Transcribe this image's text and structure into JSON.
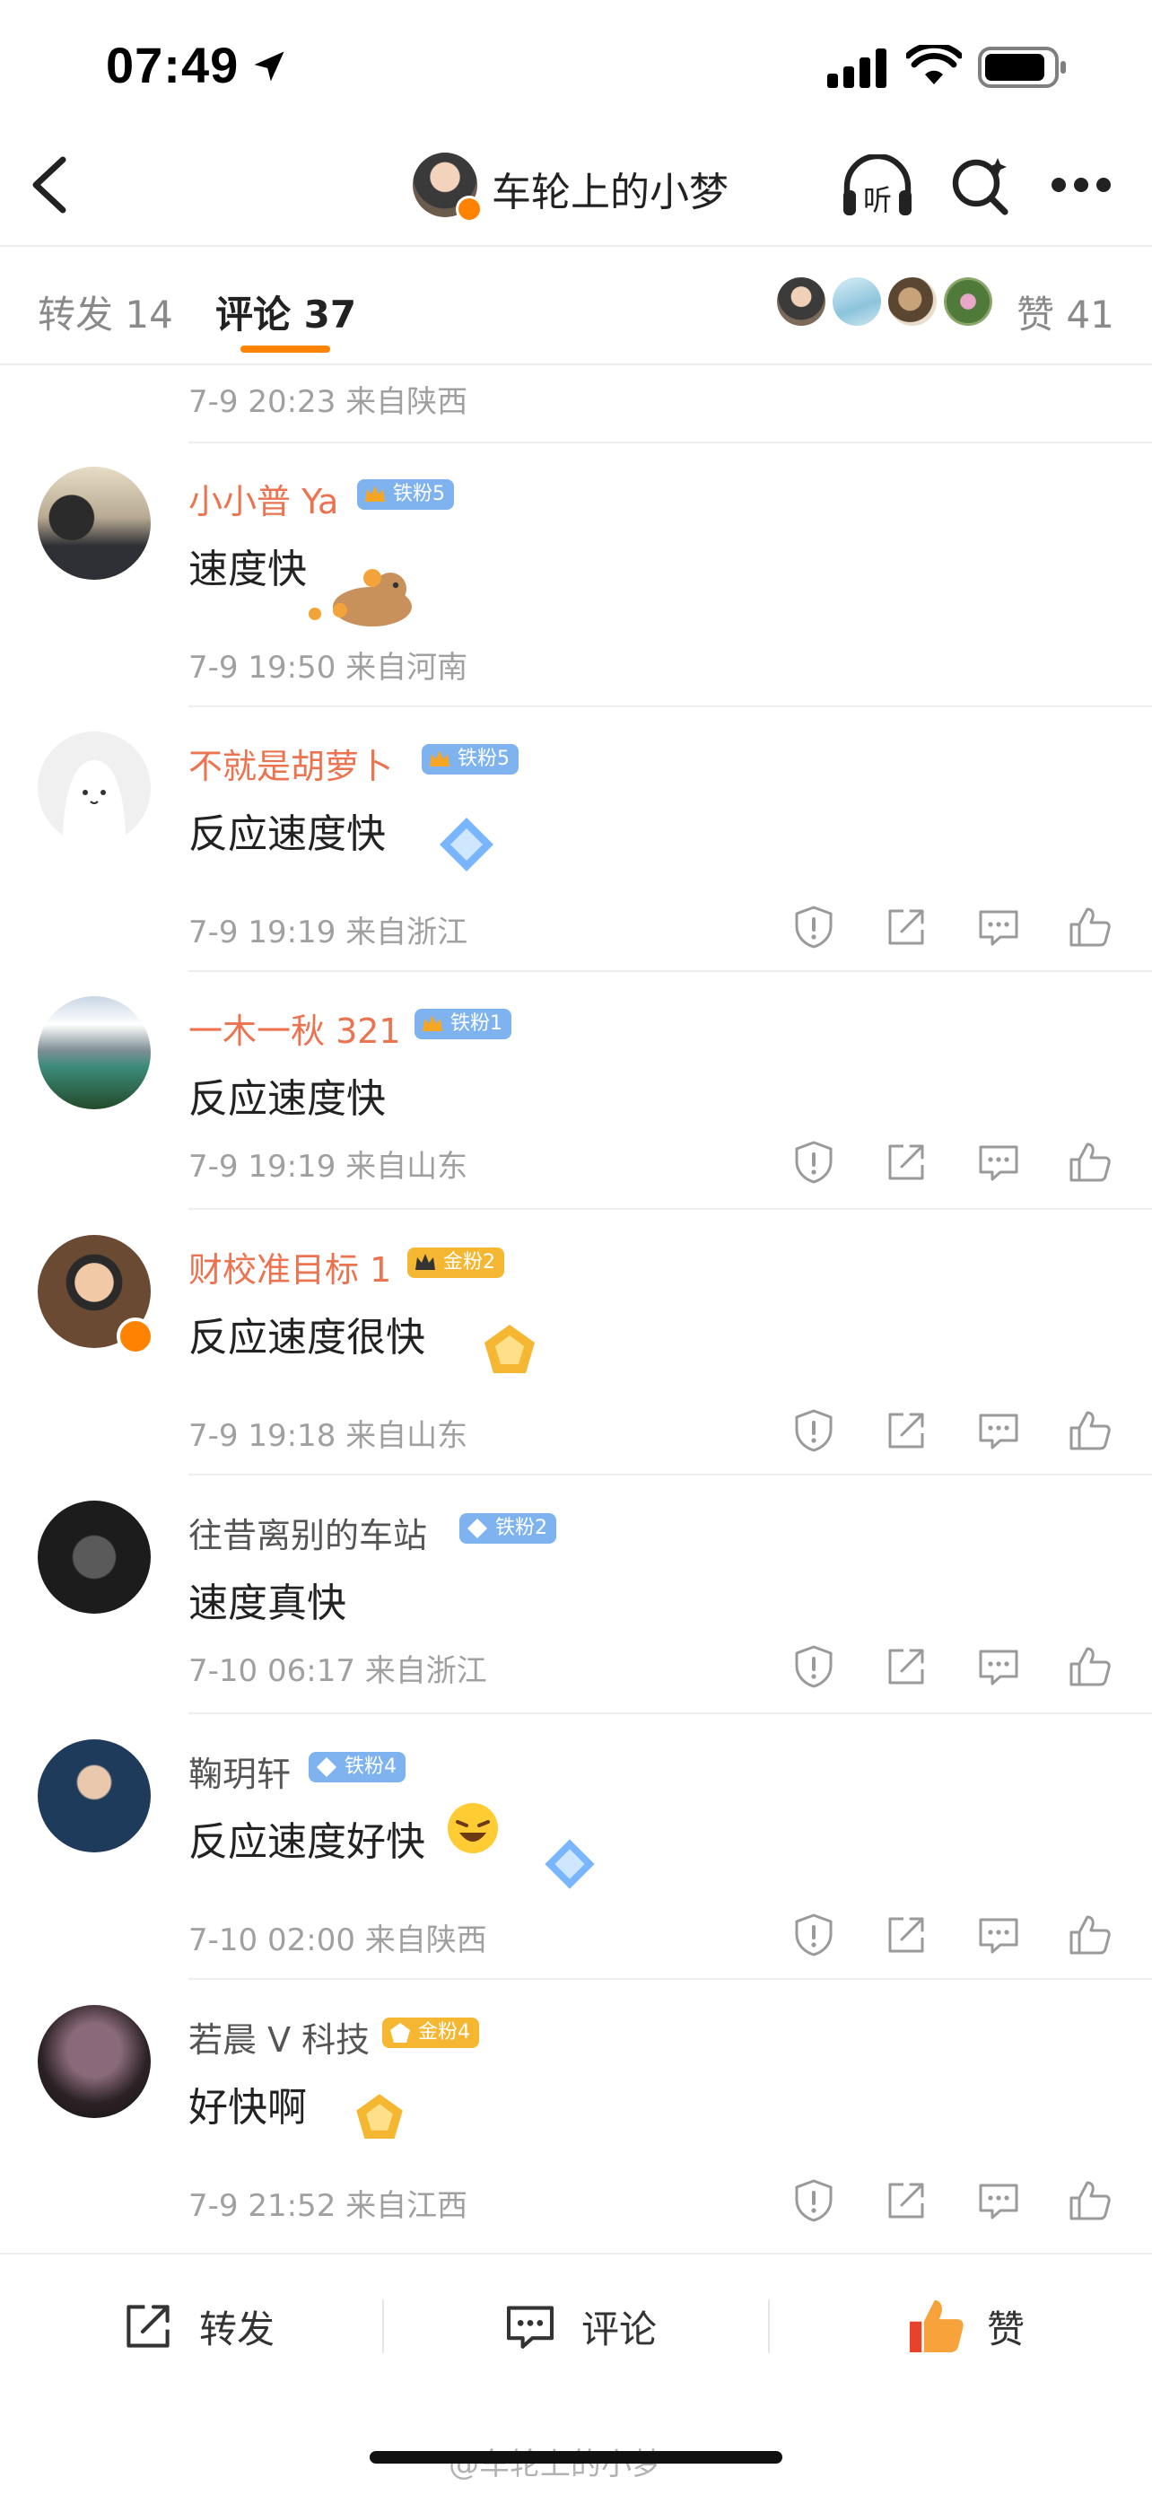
{
  "status_bar": {
    "time": "07:49"
  },
  "header": {
    "author_name": "车轮上的小梦",
    "listen_label": "听"
  },
  "tabs": {
    "repost_label": "转发",
    "repost_count": "14",
    "comment_label": "评论",
    "comment_count": "37",
    "like_label": "赞",
    "like_count": "41"
  },
  "prev_comment_meta": "7-9 20:23 来自陕西",
  "comments": [
    {
      "name": "小小普 Ya",
      "badge": "铁粉5",
      "text": "速度快",
      "meta": "7-9 19:50 来自河南"
    },
    {
      "name": "不就是胡萝卜",
      "badge": "铁粉5",
      "text": "反应速度快",
      "meta": "7-9 19:19 来自浙江"
    },
    {
      "name": "一木一秋 321",
      "badge": "铁粉1",
      "text": "反应速度快",
      "meta": "7-9 19:19 来自山东"
    },
    {
      "name": "财校准目标 1",
      "badge": "金粉2",
      "text": "反应速度很快",
      "meta": "7-9 19:18 来自山东"
    },
    {
      "name": "往昔离别的车站",
      "badge": "铁粉2",
      "text": "速度真快",
      "meta": "7-10 06:17 来自浙江"
    },
    {
      "name": "鞠玥轩",
      "badge": "铁粉4",
      "text": "反应速度好快",
      "meta": "7-10 02:00 来自陕西"
    },
    {
      "name": "若晨 V 科技",
      "badge": "金粉4",
      "text": "好快啊",
      "meta": "7-9 21:52 来自江西"
    }
  ],
  "bottom_bar": {
    "repost": "转发",
    "comment": "评论",
    "like": "赞"
  },
  "watermark": "@车轮上的小梦",
  "colors": {
    "accent": "#ff8200",
    "name_orange": "#eb7350",
    "meta_gray": "#a0a0a0",
    "iron_badge": "#7fb3f0",
    "gold_badge": "#f5b731"
  },
  "icons": [
    "back-icon",
    "listen-icon",
    "search-icon",
    "more-icon",
    "report-icon",
    "share-icon",
    "reply-icon",
    "like-icon"
  ]
}
